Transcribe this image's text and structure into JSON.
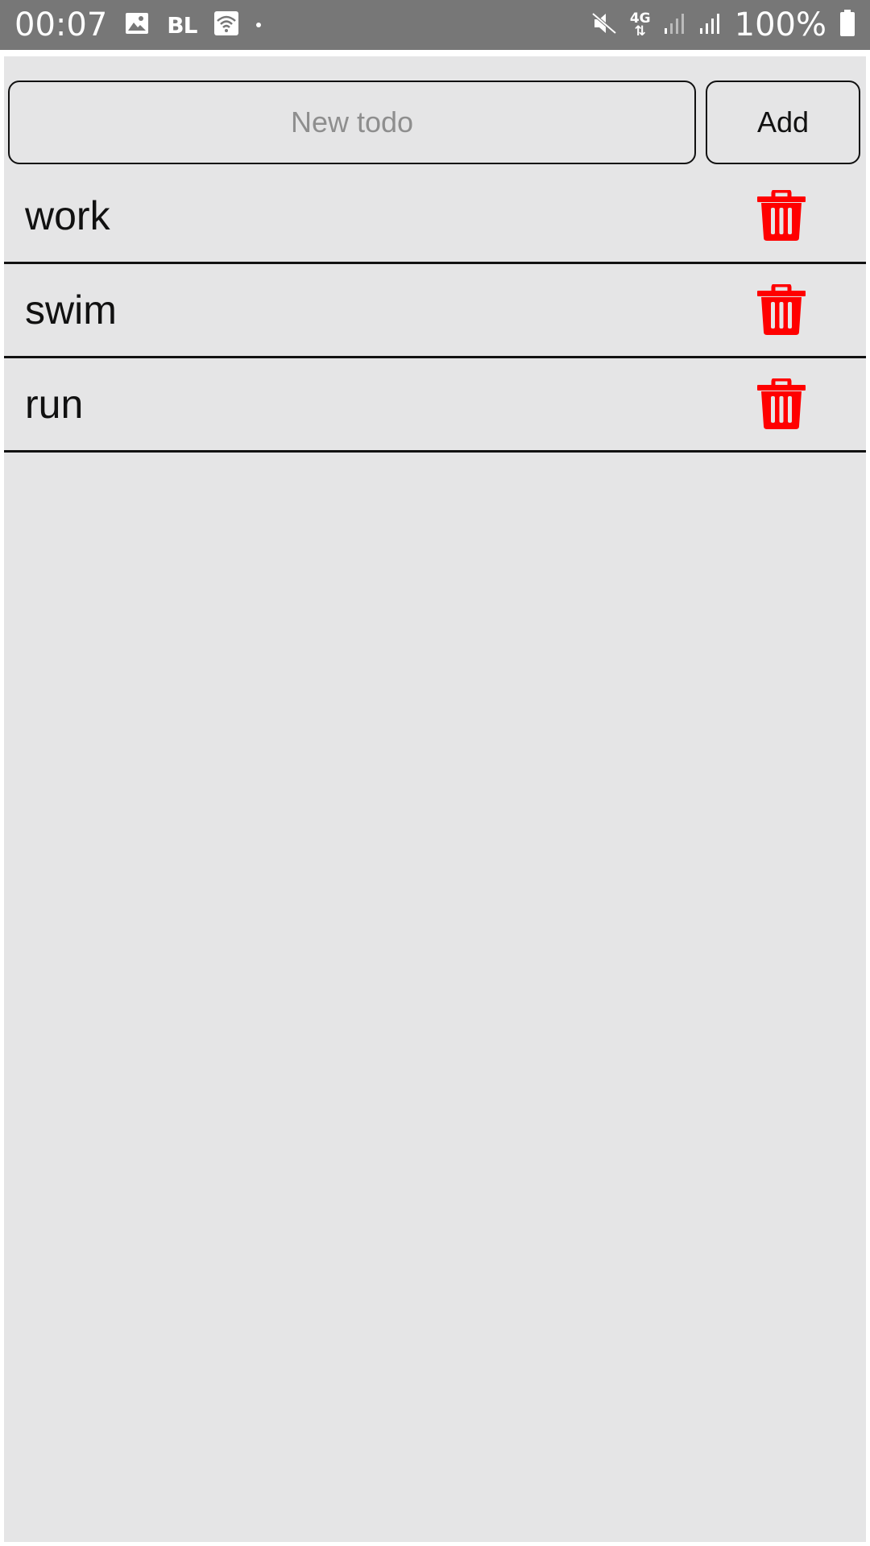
{
  "status_bar": {
    "time": "00:07",
    "battery_percent": "100%",
    "left_icons": [
      "image-icon",
      "bl-badge",
      "wifi-icon",
      "dot-icon"
    ],
    "bl_label": "BL",
    "network_label": "4G",
    "right_icons": [
      "mute-icon",
      "4g-icon",
      "signal-icon-1",
      "signal-icon-2",
      "battery-icon"
    ]
  },
  "input": {
    "placeholder": "New todo",
    "value": ""
  },
  "add_button": {
    "label": "Add"
  },
  "todos": [
    {
      "text": "work",
      "icon": "trash-icon"
    },
    {
      "text": "swim",
      "icon": "trash-icon"
    },
    {
      "text": "run",
      "icon": "trash-icon"
    }
  ],
  "colors": {
    "status_bar": "#777777",
    "background": "#e5e5e6",
    "delete_icon": "#ff0000",
    "border": "#111111",
    "placeholder": "#8e8e8e"
  }
}
